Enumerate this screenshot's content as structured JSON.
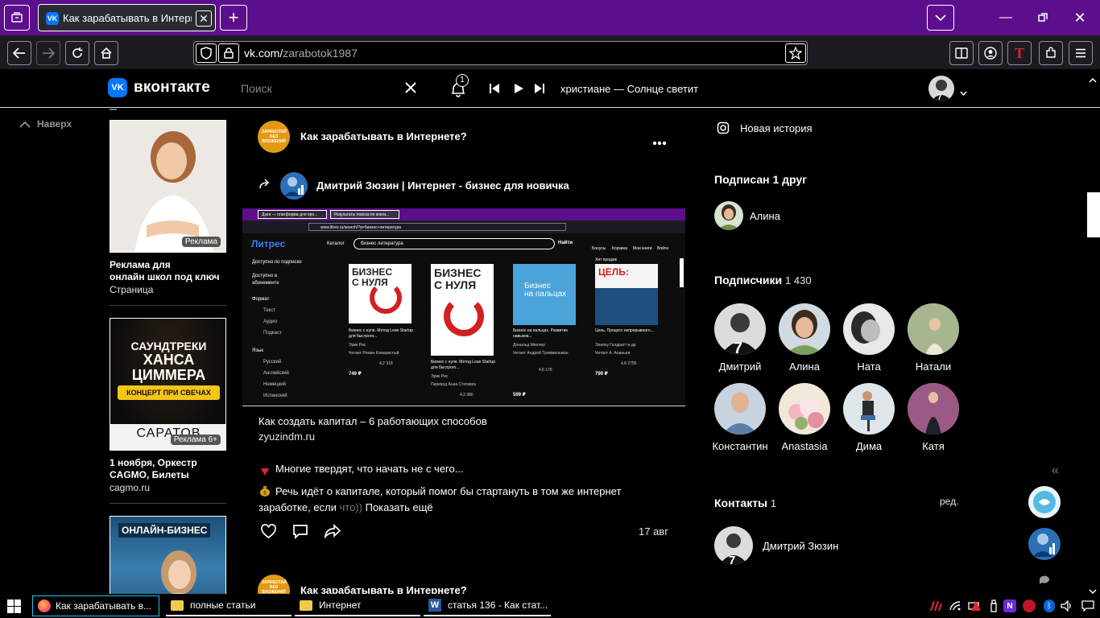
{
  "browser": {
    "tab_title": "Как зарабатывать в Интернет",
    "url_domain": "vk.com/",
    "url_path": "zarabotok1987"
  },
  "vk_header": {
    "logo_text": "вконтакте",
    "search_placeholder": "Поиск",
    "notification_count": "1",
    "player_track": "христиане — Солнце светит"
  },
  "left_nav": {
    "back_to_top": "Наверх"
  },
  "ads": [
    {
      "badge": "Реклама",
      "title_line1": "Реклама для",
      "title_line2": "онлайн школ под ключ",
      "subtitle": "Страница"
    },
    {
      "banner_line1": "САУНДТРЕКИ",
      "banner_line2": "ХАНСА",
      "banner_line3": "ЦИММЕРА",
      "banner_tag": "КОНЦЕРТ ПРИ СВЕЧАХ",
      "banner_city": "САРАТОВ",
      "badge": "Реклама 6+",
      "title_line1": "1 ноября, Оркестр",
      "title_line2": "CAGMO, Билеты",
      "subtitle": "cagmo.ru"
    },
    {
      "banner_line1": "ОНЛАЙН-БИЗНЕС"
    }
  ],
  "post": {
    "group_name": "Как зарабатывать в Интернете?",
    "group_avatar_text": "ЗАРАБОТАЙ БЕЗ ВЛОЖЕНИЙ",
    "repost_author": "Дмитрий Зюзин | Интернет - бизнес для новичка",
    "link_title": "Как создать капитал – 6 работающих способов",
    "link_domain": "zyuzindm.ru",
    "text_line1": "Многие твердят, что начать не с чего...",
    "text_line2": "Речь идёт о капитале, который помог бы стартануть в том же интернет",
    "text_line3_start": "заработке, если ",
    "text_line3_fade": "что))",
    "show_more": "Показать ещё",
    "date": "17 авг",
    "next_group_name": "Как зарабатывать в Интернете?"
  },
  "screenshot": {
    "tab1": "Дзен — платформа для про...",
    "tab2": "Результаты поиска по книга...",
    "url": "www.litres.ru/search/?q=бизнес+литература",
    "logo": "Литрес",
    "catalog": "Каталог",
    "search_value": "бизнес литература",
    "search_btn": "Найти",
    "nav": [
      "Бонусы",
      "Корзина",
      "Мои книги",
      "Войти"
    ],
    "filters": [
      "Доступно по подписке",
      "Доступно в абонементе",
      "Формат",
      "Текст",
      "Аудио",
      "Подкаст",
      "Язык",
      "Русский",
      "Английский",
      "Немецкий",
      "Испанский"
    ],
    "hit_label": "Хит продаж",
    "books": [
      {
        "cover1": "БИЗНЕС",
        "cover2": "С НУЛЯ",
        "title": "Бизнес с нуля. Метод Lean Startup для быстрого...",
        "author": "Эрик Рис",
        "reader": "Читает Роман Комаристый",
        "rating": "4,2 318",
        "price": "749 ₽"
      },
      {
        "cover1": "БИЗНЕС",
        "cover2": "С НУЛЯ",
        "title": "Бизнес с нуля. Метод Lean Startup для быстрого...",
        "author": "Эрик Рис",
        "reader": "Перевод Анна Стативка",
        "rating": "4,3 380",
        "price": ""
      },
      {
        "cover1": "Бизнес",
        "cover2": "на пальцах",
        "title": "Бизнес на пальцах. Развитие навыков...",
        "author": "Дональд Миллер",
        "reader": "Читает Андрей Троммельман",
        "rating": "4,6 176",
        "price": "599 ₽"
      },
      {
        "cover1": "ЦЕЛЬ:",
        "cover2": "",
        "title": "Цель. Процесс непрерывного...",
        "author": "Элияху Голдратт и др.",
        "reader": "Читает А. Ананьев",
        "rating": "4,8 2756",
        "price": "799 ₽"
      }
    ]
  },
  "right_col": {
    "new_story": "Новая история",
    "friends_title": "Подписан 1 друг",
    "friend_name": "Алина",
    "subscribers_title": "Подписчики",
    "subscribers_count": "1 430",
    "subscribers": [
      "Дмитрий",
      "Алина",
      "Ната",
      "Натали",
      "Константин",
      "Anastasia",
      "Дима",
      "Катя"
    ],
    "contacts_title": "Контакты",
    "contacts_count": "1",
    "contacts_edit": "ред.",
    "contact_name": "Дмитрий Зюзин"
  },
  "taskbar": {
    "items": [
      "Как зарабатывать в...",
      "полные статьи",
      "Интернет",
      "статья 136 - Как стат..."
    ]
  }
}
